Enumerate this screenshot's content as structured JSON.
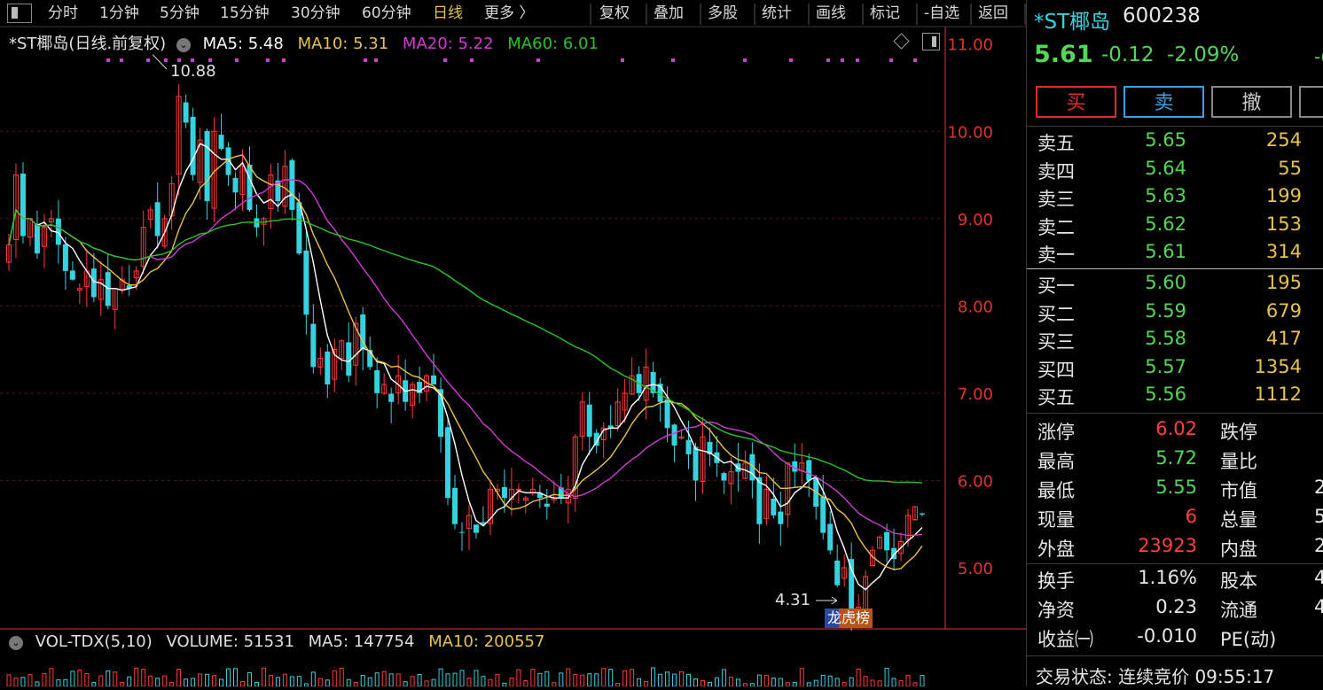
{
  "toolbar": {
    "periods": [
      "分时",
      "1分钟",
      "5分钟",
      "15分钟",
      "30分钟",
      "60分钟",
      "日线",
      "更多 〉"
    ],
    "active_period": "日线",
    "tools": [
      "复权",
      "叠加",
      "多股",
      "统计",
      "画线",
      "标记",
      "-自选",
      "返回"
    ]
  },
  "legend": {
    "name": "*ST椰岛(日线.前复权)",
    "ma5": "MA5: 5.48",
    "ma10": "MA10: 5.31",
    "ma20": "MA20: 5.22",
    "ma60": "MA60: 6.01"
  },
  "volume_legend": {
    "name": "VOL-TDX(5,10)",
    "volume": "VOLUME: 51531",
    "ma5": "MA5: 147754",
    "ma10": "MA10: 200557"
  },
  "annotations": {
    "high": "10.88",
    "low": "4.31",
    "badge": "龙虎榜"
  },
  "colors": {
    "up": "#ff3b3b",
    "down": "#35d2e0",
    "ma5": "#ffffff",
    "ma10": "#e8c24a",
    "ma20": "#d23ad6",
    "ma60": "#28c32a",
    "axis": "#e2332f",
    "buy_btn": "#e22b2b",
    "sell_btn": "#3aa0e0"
  },
  "chart_data": {
    "type": "candlestick",
    "ylim": [
      4.3,
      11.2
    ],
    "y_ticks": [
      "11.00",
      "10.00",
      "9.00",
      "8.00",
      "7.00",
      "6.00",
      "5.00"
    ],
    "close": [
      8.7,
      9.5,
      8.8,
      9.0,
      8.6,
      8.9,
      9.0,
      8.7,
      8.4,
      8.3,
      8.2,
      8.4,
      8.1,
      8.3,
      8.0,
      8.2,
      8.3,
      8.2,
      8.4,
      8.9,
      9.1,
      8.8,
      9.0,
      9.4,
      10.4,
      10.1,
      9.5,
      9.9,
      9.2,
      10.0,
      9.8,
      9.5,
      9.3,
      9.6,
      9.1,
      8.9,
      9.0,
      9.5,
      9.2,
      9.6,
      9.1,
      8.6,
      7.9,
      7.3,
      7.4,
      7.1,
      7.5,
      7.6,
      7.2,
      7.8,
      7.5,
      7.3,
      7.0,
      7.1,
      6.9,
      7.2,
      6.9,
      7.1,
      7.0,
      7.2,
      7.1,
      6.5,
      5.8,
      5.5,
      5.4,
      5.6,
      5.4,
      5.5,
      5.9,
      5.9,
      5.8,
      5.9,
      5.9,
      5.8,
      5.9,
      5.8,
      5.7,
      5.8,
      5.8,
      5.9,
      6.5,
      6.9,
      6.5,
      6.4,
      6.6,
      6.6,
      6.9,
      7.0,
      7.2,
      7.0,
      7.3,
      7.0,
      6.9,
      6.6,
      6.4,
      6.5,
      6.3,
      6.0,
      6.5,
      6.3,
      6.2,
      6.0,
      6.1,
      6.1,
      6.2,
      6.0,
      5.5,
      5.9,
      5.6,
      5.5,
      6.2,
      6.1,
      6.2,
      6.0,
      5.7,
      5.4,
      5.2,
      4.8,
      5.0,
      4.5,
      4.55,
      4.9,
      5.2,
      5.35,
      5.2,
      5.1,
      5.3,
      5.6,
      5.7,
      5.61
    ]
  },
  "quote": {
    "name": "*ST椰岛",
    "code": "600238",
    "price": "5.61",
    "change": "-0.12",
    "pct": "-2.09%",
    "extra": "-("
  },
  "buttons": {
    "buy": "买",
    "sell": "卖",
    "cancel": "撤"
  },
  "order_book": {
    "asks": [
      {
        "label": "卖五",
        "price": "5.65",
        "vol": "254"
      },
      {
        "label": "卖四",
        "price": "5.64",
        "vol": "55"
      },
      {
        "label": "卖三",
        "price": "5.63",
        "vol": "199"
      },
      {
        "label": "卖二",
        "price": "5.62",
        "vol": "153"
      },
      {
        "label": "卖一",
        "price": "5.61",
        "vol": "314"
      }
    ],
    "bids": [
      {
        "label": "买一",
        "price": "5.60",
        "vol": "195"
      },
      {
        "label": "买二",
        "price": "5.59",
        "vol": "679"
      },
      {
        "label": "买三",
        "price": "5.58",
        "vol": "417"
      },
      {
        "label": "买四",
        "price": "5.57",
        "vol": "1354"
      },
      {
        "label": "买五",
        "price": "5.56",
        "vol": "1112"
      }
    ]
  },
  "stats": [
    {
      "label": "涨停",
      "value": "6.02",
      "value_color": "#ff4040",
      "label2": "跌停",
      "value2": ""
    },
    {
      "label": "最高",
      "value": "5.72",
      "value_color": "#55d659",
      "label2": "量比",
      "value2": ""
    },
    {
      "label": "最低",
      "value": "5.55",
      "value_color": "#55d659",
      "label2": "市值",
      "value2": "2"
    },
    {
      "label": "现量",
      "value": "6",
      "value_color": "#ff4040",
      "label2": "总量",
      "value2": "5"
    },
    {
      "label": "外盘",
      "value": "23923",
      "value_color": "#ff4040",
      "label2": "内盘",
      "value2": "2"
    }
  ],
  "stats2": [
    {
      "label": "换手",
      "value": "1.16%",
      "label2": "股本",
      "value2": "4"
    },
    {
      "label": "净资",
      "value": "0.23",
      "label2": "流通",
      "value2": "4"
    },
    {
      "label": "收益㈠",
      "value": "-0.010",
      "label2": "PE(动)",
      "value2": ""
    }
  ],
  "status": {
    "text": "交易状态: 连续竞价 09:55:17"
  }
}
